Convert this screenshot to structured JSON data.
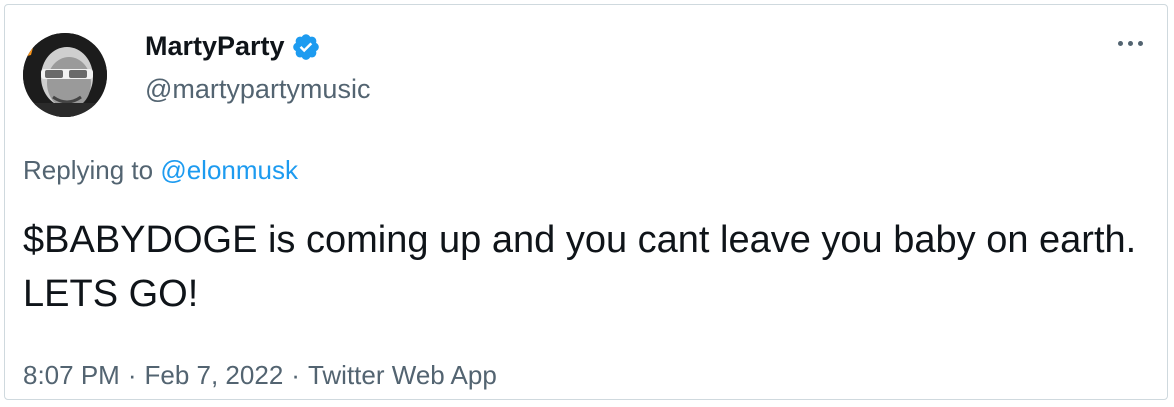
{
  "tweet": {
    "author": {
      "display_name": "MartyParty",
      "handle": "@martypartymusic",
      "verified": true,
      "avatar_icon": "bald-man-with-glasses-avatar"
    },
    "more_icon": "more-options-icon",
    "replying_prefix": "Replying to",
    "replying_to": "@elonmusk",
    "text": "$BABYDOGE is coming up and you cant leave you baby on earth. LETS GO!",
    "time": "8:07 PM",
    "separator": "·",
    "date": "Feb 7, 2022",
    "source": "Twitter Web App",
    "colors": {
      "link": "#1d9bf0",
      "verified": "#1d9bf0",
      "text": "#0f1419",
      "secondary": "#536471",
      "border": "#cfd9de"
    }
  }
}
